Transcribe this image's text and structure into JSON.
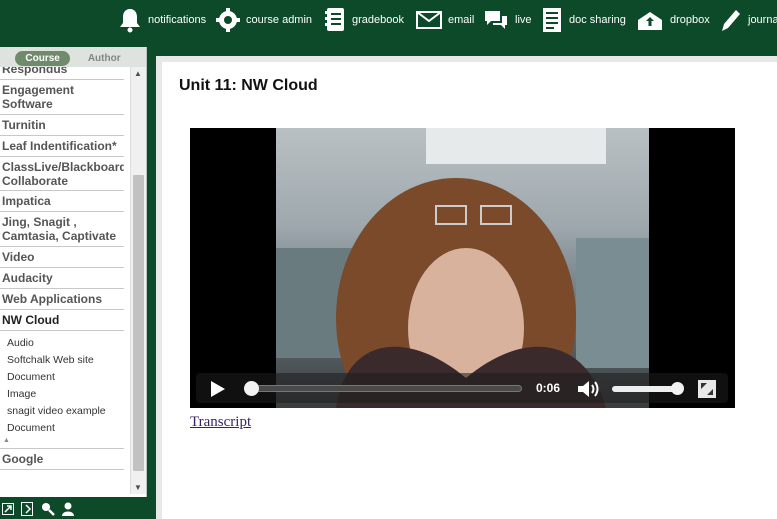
{
  "nav": {
    "items": [
      {
        "label": "notifications",
        "icon": "bell-icon"
      },
      {
        "label": "course admin",
        "icon": "gear-icon"
      },
      {
        "label": "gradebook",
        "icon": "gradebook-icon"
      },
      {
        "label": "email",
        "icon": "envelope-icon"
      },
      {
        "label": "live",
        "icon": "chat-bubbles-icon"
      },
      {
        "label": "doc sharing",
        "icon": "document-icon"
      },
      {
        "label": "dropbox",
        "icon": "dropbox-icon"
      },
      {
        "label": "journal",
        "icon": "pen-icon"
      }
    ]
  },
  "sidebar": {
    "tabs": {
      "course": "Course",
      "author": "Author"
    },
    "items": [
      "Respondus",
      "Engagement Software",
      "Turnitin",
      "Leaf Indentification*",
      "ClassLive/Blackboard Collaborate",
      "Impatica",
      "Jing, Snagit , Camtasia, Captivate",
      "Video",
      "Audacity",
      "Web Applications",
      "NW Cloud"
    ],
    "subitems": [
      "Audio",
      "Softchalk Web site",
      "Document",
      "Image",
      "snagit video example",
      "Document"
    ],
    "after": [
      "Google"
    ]
  },
  "main": {
    "title": "Unit 11: NW Cloud",
    "video": {
      "time": "0:06",
      "progress": 0.02,
      "volume": 0.9
    },
    "transcript_label": "Transcript"
  },
  "colors": {
    "brand": "#0c4a2a",
    "tab_active": "#6f8b6c"
  }
}
